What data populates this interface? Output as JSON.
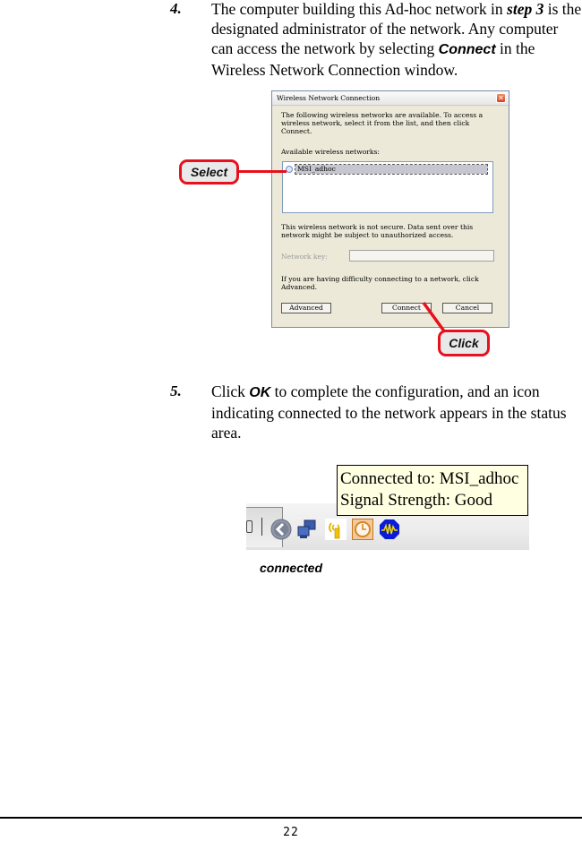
{
  "steps": [
    {
      "number": "4.",
      "text_before": "The computer building this Ad-hoc network in ",
      "emphasis_step": "step 3",
      "text_mid": " is the designated administrator of the network.  Any computer can access the network by selecting ",
      "emphasis_action": "Connect",
      "text_after": " in the Wireless Network Connection window."
    },
    {
      "number": "5.",
      "text_before": "Click ",
      "emphasis_action": "OK",
      "text_after": " to complete the configuration, and an icon indicating connected to the network appears in the status area."
    }
  ],
  "dialog": {
    "title": "Wireless Network Connection",
    "close_glyph": "✕",
    "intro": "The following wireless networks are available. To access a wireless network, select it from the list, and then click Connect.",
    "list_label": "Available wireless networks:",
    "networks": [
      {
        "name": "MSI_adhoc",
        "selected": true
      }
    ],
    "security_warning": "This wireless network is not secure. Data sent over this network might be subject to unauthorized access.",
    "key_label": "Network key:",
    "key_value": "",
    "help_text": "If you are having difficulty connecting to a network, click Advanced.",
    "buttons": {
      "advanced": "Advanced",
      "connect": "Connect",
      "cancel": "Cancel"
    }
  },
  "callouts": {
    "select": "Select",
    "click": "Click"
  },
  "tray": {
    "tooltip_line1": "Connected to: MSI_adhoc",
    "tooltip_line2": "Signal Strength: Good",
    "icons": [
      "show-hidden-icons-chevron",
      "network-connections-icon",
      "wireless-signal-icon",
      "clock-icon",
      "audio-wave-icon"
    ],
    "caption": "connected"
  },
  "footer": {
    "page_number": "22"
  }
}
